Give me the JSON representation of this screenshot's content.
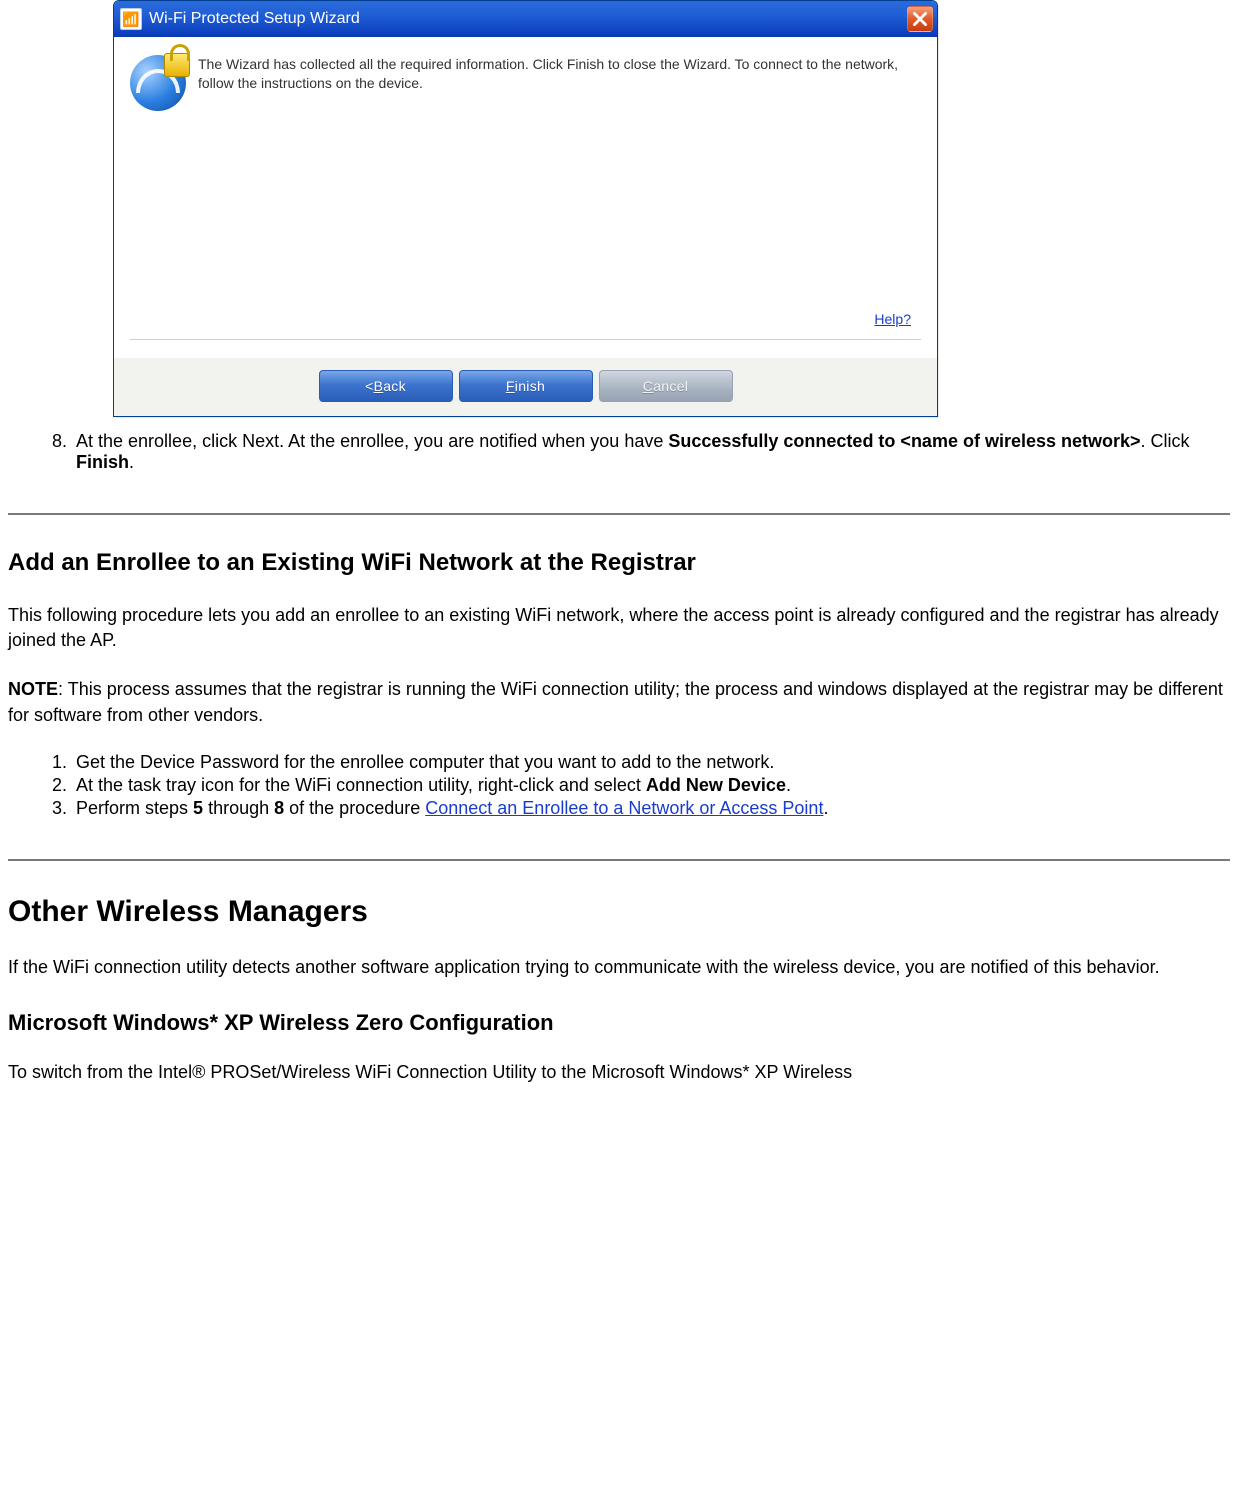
{
  "wizard": {
    "title": "Wi-Fi Protected Setup Wizard",
    "message": "The Wizard has collected all the required information. Click Finish to close the Wizard. To connect to the network, follow the instructions on the device.",
    "help_label": "Help?",
    "buttons": {
      "back_prefix": "< ",
      "back_key": "B",
      "back_rest": "ack",
      "finish_key": "F",
      "finish_rest": "inish",
      "cancel_key": "C",
      "cancel_rest": "ancel"
    },
    "icons": {
      "app": "wifi-wizard-app-icon",
      "close": "close-icon",
      "wifi_lock": "wifi-lock-icon"
    }
  },
  "step8": {
    "number": "8",
    "t1": "At the enrollee, click Next. At the enrollee, you are notified when you have ",
    "b1": "Successfully connected to <name of wireless network>",
    "t2": ". Click ",
    "b2": "Finish",
    "t3": "."
  },
  "section_add": {
    "heading": "Add an Enrollee to an Existing WiFi Network at the Registrar",
    "p1": "This following procedure lets you add an enrollee to an existing WiFi network, where the access point is already configured and the registrar has already joined the AP.",
    "note_label": "NOTE",
    "note_text": ": This process assumes that the registrar is running the WiFi connection utility; the process and windows displayed at the registrar may be different for software from other vendors.",
    "items": {
      "i1": "Get the Device Password for the enrollee computer that you want to add to the network.",
      "i2_a": "At the task tray icon for the WiFi connection utility, right-click and select ",
      "i2_b": "Add New Device",
      "i2_c": ".",
      "i3_a": "Perform steps ",
      "i3_b": "5",
      "i3_c": " through ",
      "i3_d": "8",
      "i3_e": " of the procedure ",
      "i3_link": "Connect an Enrollee to a Network or Access Point",
      "i3_f": "."
    }
  },
  "section_other": {
    "heading": "Other Wireless Managers",
    "p1": "If the WiFi connection utility detects another software application trying to communicate with the wireless device, you are notified of this behavior.",
    "sub": "Microsoft Windows* XP Wireless Zero Configuration",
    "p2": "To switch from the Intel® PROSet/Wireless WiFi Connection Utility to the Microsoft Windows* XP Wireless"
  }
}
